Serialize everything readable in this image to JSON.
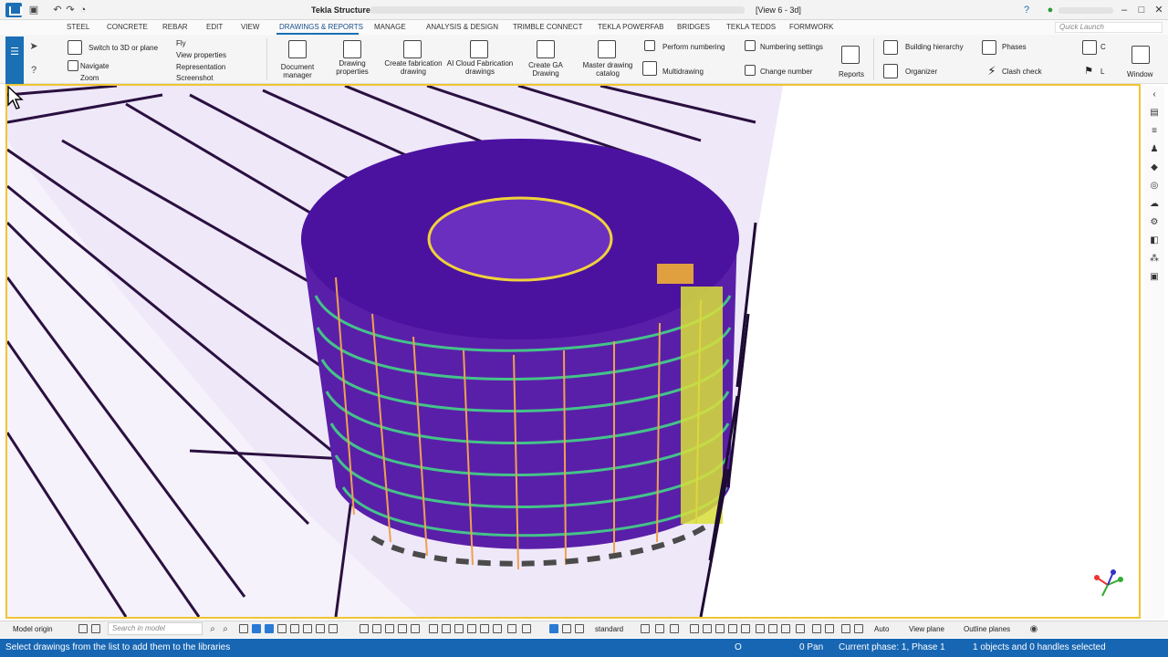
{
  "titlebar": {
    "app_title": "Tekla Structures -",
    "view_title": "[View 6 - 3d]",
    "icons": [
      "save-icon",
      "undo-icon",
      "redo-icon",
      "history-icon",
      "help-icon",
      "user-icon",
      "minimize-icon",
      "maximize-icon",
      "close-icon"
    ]
  },
  "menu": {
    "items": [
      "STEEL",
      "CONCRETE",
      "REBAR",
      "EDIT",
      "VIEW",
      "DRAWINGS & REPORTS",
      "MANAGE",
      "ANALYSIS & DESIGN",
      "TRIMBLE CONNECT",
      "TEKLA POWERFAB",
      "BRIDGES",
      "TEKLA TEDDS",
      "FORMWORK"
    ],
    "active": "DRAWINGS & REPORTS",
    "quick_launch_placeholder": "Quick Launch"
  },
  "ribbon": {
    "switch_3d": "Switch to 3D or plane",
    "navigate": "Navigate",
    "zoom": "Zoom",
    "fly": "Fly",
    "view_properties": "View properties",
    "representation": "Representation",
    "screenshot": "Screenshot",
    "document_manager": [
      "Document",
      "manager"
    ],
    "drawing_properties": [
      "Drawing",
      "properties"
    ],
    "create_fabrication": [
      "Create fabrication",
      "drawing"
    ],
    "ai_cloud": [
      "AI Cloud Fabrication",
      "drawings"
    ],
    "create_ga": [
      "Create GA",
      "Drawing"
    ],
    "master_catalog": [
      "Master drawing",
      "catalog"
    ],
    "perform_numbering": "Perform numbering",
    "numbering_settings": "Numbering settings",
    "multidrawing": "Multidrawing",
    "change_number": "Change number",
    "reports": "Reports",
    "building_hierarchy": "Building hierarchy",
    "phases": "Phases",
    "organizer": "Organizer",
    "clash_check": "Clash check",
    "window": "Window",
    "truncated_c": "C",
    "truncated_l": "L"
  },
  "bottom_toolbar": {
    "model_origin": "Model origin",
    "search_placeholder": "Search in model",
    "standard": "standard",
    "auto": "Auto",
    "view_plane": "View plane",
    "outline_planes": "Outline planes"
  },
  "statusbar": {
    "message": "Select drawings from the list to add them to the libraries",
    "o_indicator": "O",
    "pan": "0 Pan",
    "phase": "Current phase: 1, Phase 1",
    "selection": "1 objects and 0 handles selected"
  },
  "colors": {
    "accent": "#1a6fb5",
    "status_bar": "#1766b3",
    "viewport_border": "#f0c534",
    "model_purple": "#5a1fa8",
    "slab_lavender": "#e6dcf5"
  }
}
